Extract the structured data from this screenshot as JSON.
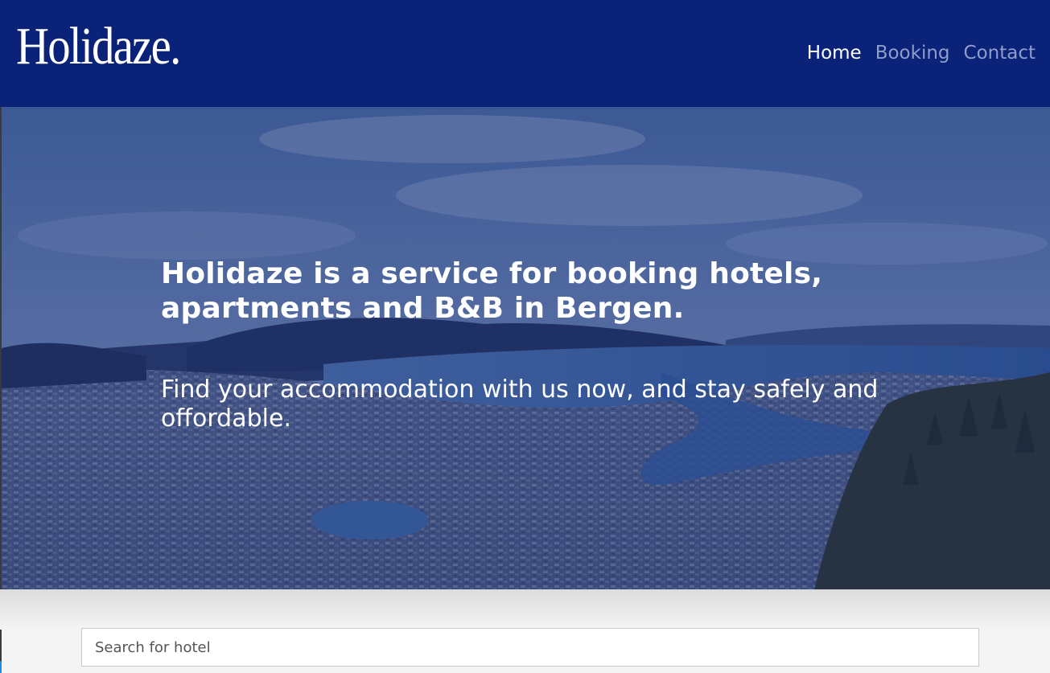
{
  "header": {
    "logo": "Holidaze.",
    "nav": [
      {
        "label": "Home",
        "active": true
      },
      {
        "label": "Booking",
        "active": false
      },
      {
        "label": "Contact",
        "active": false
      }
    ],
    "background": "#0a2277"
  },
  "hero": {
    "title": "Holidaze is a service for booking hotels, apartments and B&B in Bergen.",
    "subtitle": "Find your accommodation with us now, and stay safely and offordable.",
    "image": "aerial-city-bergen-fjord-photo"
  },
  "search": {
    "placeholder": "Search for hotel",
    "value": ""
  }
}
